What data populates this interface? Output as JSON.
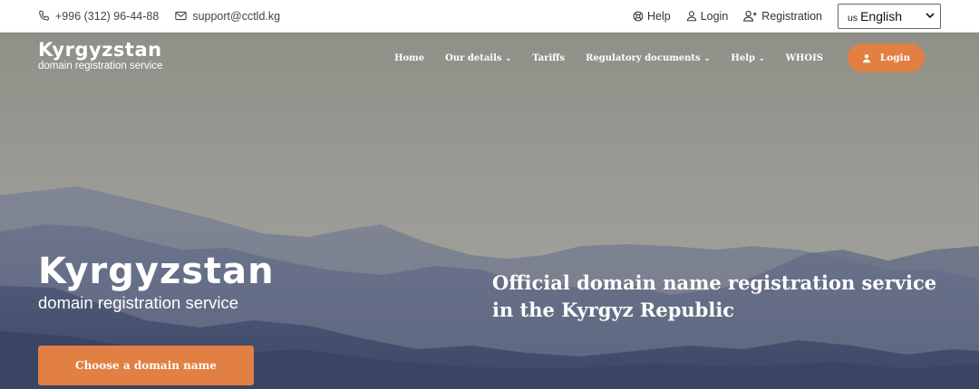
{
  "topbar": {
    "phone": "+996 (312) 96-44-88",
    "email": "support@cctld.kg",
    "help": "Help",
    "login": "Login",
    "registration": "Registration",
    "language": {
      "code": "us",
      "selected": "English"
    }
  },
  "brand": {
    "name": "Kyrgyzstan",
    "tagline": "domain registration service"
  },
  "nav": {
    "items": [
      {
        "label": "Home"
      },
      {
        "label": "Our details"
      },
      {
        "label": "Tariffs"
      },
      {
        "label": "Regulatory documents"
      },
      {
        "label": "Help"
      },
      {
        "label": "WHOIS"
      }
    ],
    "login": "Login"
  },
  "hero": {
    "headline_line1": "Official domain name registration service",
    "headline_line2": "in the Kyrgyz Republic",
    "cta": "Choose a domain name"
  },
  "colors": {
    "accent": "#e27f43",
    "sky": "#9a9b94",
    "mountain_dark": "#3c4766"
  }
}
